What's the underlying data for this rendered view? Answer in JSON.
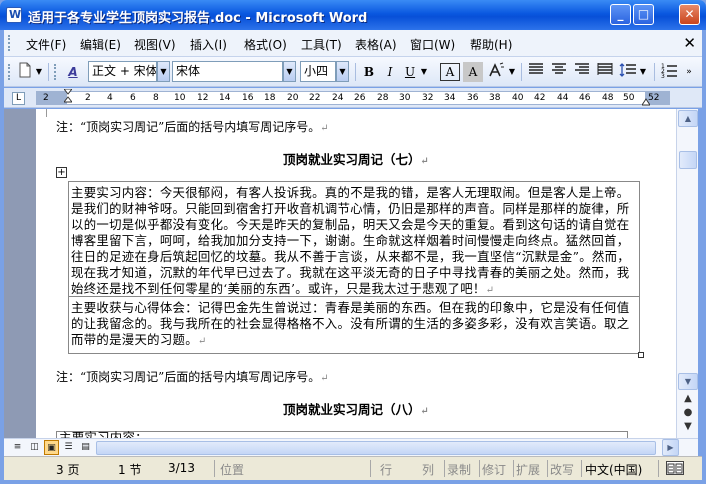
{
  "window": {
    "title": "适用于各专业学生顶岗实习报告.doc - Microsoft Word",
    "minimize": "_",
    "maximize": "□",
    "close": "✕"
  },
  "menu": {
    "items": [
      "文件(F)",
      "编辑(E)",
      "视图(V)",
      "插入(I)",
      "格式(O)",
      "工具(T)",
      "表格(A)",
      "窗口(W)",
      "帮助(H)"
    ],
    "doc_close": "✕"
  },
  "toolbar": {
    "style_value": "正文 + 宋体",
    "font_value": "宋体",
    "size_value": "小四",
    "bold": "B",
    "italic": "I",
    "underline": "U",
    "char_border": "A",
    "char_shading": "A"
  },
  "ruler": {
    "numbers": [
      "2",
      "2",
      "4",
      "6",
      "8",
      "10",
      "12",
      "14",
      "16",
      "18",
      "20",
      "22",
      "24",
      "26",
      "28",
      "30",
      "32",
      "34",
      "36",
      "38",
      "40",
      "42",
      "44",
      "46",
      "48",
      "50",
      "52"
    ]
  },
  "document": {
    "note1": "注：“顶岗实习周记”后面的括号内填写周记序号。",
    "heading1": "顶岗就业实习周记（七）",
    "table_lines_main": [
      "主要实习内容：今天很郁闷，有客人投诉我。真的不是我的错，是客人无理取闹。但是客人是上帝。",
      "是我们的财神爷呀。只能回到宿舍打开收音机调节心情，仍旧是那样的声音。同样是那样的旋律，所",
      "以的一切是似乎都没有变化。今天是昨天的复制品，明天又会是今天的重复。看到这句话的请自觉在",
      "博客里留下言，呵呵，给我加加分支持一下，谢谢。生命就这样烟着时间慢慢走向终点。猛然回首，",
      "往日的足迹在身后筑起回忆的坟墓。我从不善于言谈，从来都不是，我一直坚信“沉默是金”。然而，",
      "现在我才知道，沉默的年代早已过去了。我就在这平淡无奇的日子中寻找青春的美丽之处。然而，我",
      "始终还是找不到任何零星的‘美丽的东西’。或许，只是我太过于悲观了吧！"
    ],
    "table_lines_harvest": [
      "主要收获与心得体会：记得巴金先生曾说过：青春是美丽的东西。但在我的印象中，它是没有任何值",
      "的让我留念的。我与我所在的社会显得格格不入。没有所谓的生活的多姿多彩，没有欢言笑语。取之",
      "而带的是漫天的习题。"
    ],
    "note2": "注：“顶岗实习周记”后面的括号内填写周记序号。",
    "heading2": "顶岗就业实习周记（八）",
    "next_table_line": "主要实习内容："
  },
  "statusbar": {
    "page": "3 页",
    "section": "1 节",
    "page_of": "3/13",
    "position": "位置",
    "line": "行",
    "column": "列",
    "record": "录制",
    "revise": "修订",
    "extend": "扩展",
    "overtype": "改写",
    "language": "中文(中国)"
  }
}
